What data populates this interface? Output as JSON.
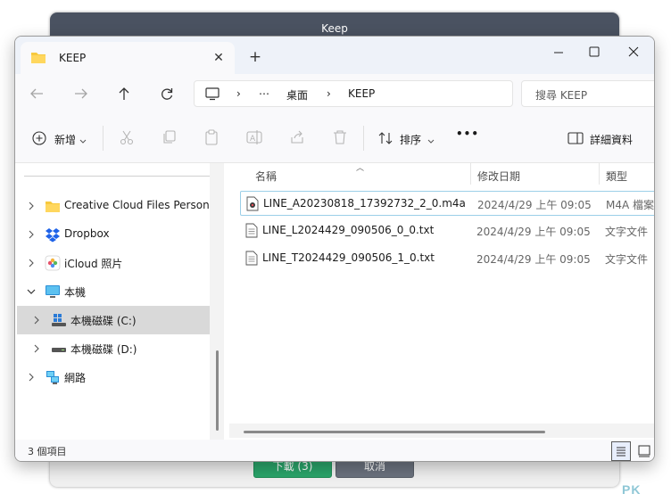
{
  "background_dialog": {
    "title": "Keep",
    "download_label": "下載 (3)",
    "cancel_label": "取消"
  },
  "watermark": "PK",
  "explorer": {
    "tab_title": "KEEP",
    "breadcrumb": [
      "⋯",
      "桌面",
      "KEEP"
    ],
    "search_placeholder": "搜尋 KEEP",
    "toolbar": {
      "new_label": "新增",
      "sort_label": "排序",
      "more_label": "•••",
      "details_label": "詳細資料"
    },
    "nav": [
      {
        "label": "Creative Cloud Files Personal",
        "icon": "creative-cloud-folder-icon"
      },
      {
        "label": "Dropbox",
        "icon": "dropbox-icon"
      },
      {
        "label": "iCloud 照片",
        "icon": "icloud-photos-icon"
      },
      {
        "label": "本機",
        "icon": "computer-icon"
      },
      {
        "label": "本機磁碟 (C:)",
        "icon": "windows-drive-icon"
      },
      {
        "label": "本機磁碟 (D:)",
        "icon": "drive-icon"
      },
      {
        "label": "網路",
        "icon": "network-icon"
      }
    ],
    "columns": {
      "name": "名稱",
      "date": "修改日期",
      "type": "類型"
    },
    "files": [
      {
        "name": "LINE_A20230818_17392732_2_0.m4a",
        "date": "2024/4/29 上午 09:05",
        "type": "M4A 檔案",
        "icon": "audio-file-icon"
      },
      {
        "name": "LINE_L2024429_090506_0_0.txt",
        "date": "2024/4/29 上午 09:05",
        "type": "文字文件",
        "icon": "text-file-icon"
      },
      {
        "name": "LINE_T2024429_090506_1_0.txt",
        "date": "2024/4/29 上午 09:05",
        "type": "文字文件",
        "icon": "text-file-icon"
      }
    ],
    "status": "3 個項目"
  }
}
